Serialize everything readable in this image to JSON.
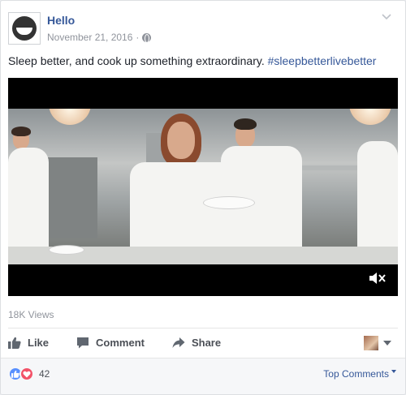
{
  "post": {
    "page_name": "Hello",
    "date": "November 21, 2016",
    "separator": "·",
    "caption_text": "Sleep better, and cook up something extraordinary.",
    "hashtag": "#sleepbetterlivebetter"
  },
  "video": {
    "views": "18K Views",
    "icons": [
      "mute-icon"
    ]
  },
  "actions": {
    "like_label": "Like",
    "comment_label": "Comment",
    "share_label": "Share"
  },
  "footer": {
    "reaction_count": "42",
    "top_comments_label": "Top Comments"
  },
  "colors": {
    "link": "#365899",
    "meta": "#90949c",
    "like_reaction": "#5890ff",
    "love_reaction": "#f25268"
  }
}
